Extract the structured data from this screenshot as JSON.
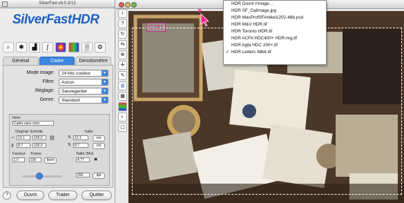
{
  "panel": {
    "window_title": "SilverFast v6.0.2r13",
    "logo": "SilverFastHDR",
    "tabs": [
      "Général",
      "Cadre",
      "Densitomètre"
    ],
    "fields": {
      "mode_image": {
        "label": "Mode image:",
        "value": "24 bits couleur"
      },
      "filtre": {
        "label": "Filtre:",
        "value": "Aucun"
      },
      "reglage": {
        "label": "Réglage:",
        "value": "Sauvegarder"
      },
      "genre": {
        "label": "Genre:",
        "value": "Standard"
      }
    },
    "nom": {
      "label": "Nom",
      "value": "Cadre sans nom-"
    },
    "size": {
      "original_label": "Original",
      "echelle_label": "Échelle",
      "taille_label": "Taille",
      "orig_w": "13.1",
      "orig_h": "8.7",
      "scale_w": "100.0",
      "scale_h": "100.0",
      "size_w": "13.1",
      "size_h": "8.7",
      "unit": "cm"
    },
    "facteur": {
      "facteur_label": "Facteur",
      "trame_label": "Trame",
      "taille_mo_label": "Taille (Mo)",
      "facteur_value": "1.0",
      "trame_value": "100",
      "lpcm": "lpcm",
      "taille_mo_value": "4.77",
      "dpi_value": "266",
      "dpi_unit": "dpi"
    },
    "buttons": {
      "help": "?",
      "ouvrir": "Ouvrir",
      "traiter": "Traiter",
      "quitter": "Quitter"
    }
  },
  "menu": {
    "items": [
      "HDR Ouvrir l'image…",
      "HDR SF_CalImage.jpg",
      "HDR MacProfSFArtikel1202-48b.psd",
      "HDR M&V HDR.tif",
      "HDR Toronto HDR.tif",
      "HDR ACFA HDC400+ HDR.reg.tif",
      "HDR Agfa HDC 200+.tif",
      "HDR Letters 48bit.tif"
    ],
    "checked_index": 7,
    "check_mark": "✓"
  },
  "crop_label": "C1R1",
  "colors": {
    "accent": "#3d86e0",
    "logo": "#1d5fc3",
    "crop": "#c02c8a"
  }
}
